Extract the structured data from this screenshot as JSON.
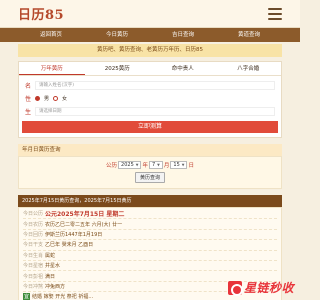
{
  "header": {
    "logo": "日历85"
  },
  "nav": [
    "返回首页",
    "今日黄历",
    "吉日查询",
    "黄道查询"
  ],
  "notice": "黄历吧、黄历查询、老黄历万年历、日历85",
  "form": {
    "tabs": [
      "万年黄历",
      "2025黄历",
      "命中贵人",
      "八字合婚"
    ],
    "name_label": "名",
    "name_placeholder": "请输入姓名(汉字)",
    "gender_label": "性",
    "gender_male": "男",
    "gender_female": "女",
    "date_label": "生",
    "date_placeholder": "请选择日期",
    "submit": "立即测算"
  },
  "query": {
    "title": "年月日黄历查询",
    "prefix": "公历",
    "year": "2025",
    "year_unit": "年",
    "month": "7",
    "month_unit": "月",
    "day": "15",
    "day_unit": "日",
    "button": "黄历查询"
  },
  "result": {
    "head": "2025年7月15日黄历查询，2025年7月15日黄历",
    "lines": [
      {
        "k": "今日公历",
        "v": "公元2025年7月15日 星期二",
        "strong": true
      },
      {
        "k": "今日农历",
        "v": "农历乙巳二零二五年 六月(大) 廿一"
      },
      {
        "k": "今日回历",
        "v": "伊斯兰历1447年1月19日"
      },
      {
        "k": "今日干支",
        "v": "乙巳年 癸未月 乙酉日"
      },
      {
        "k": "今日生肖",
        "v": "属蛇"
      },
      {
        "k": "今日星宿",
        "v": "井星水"
      },
      {
        "k": "今日彭祖",
        "v": "满日"
      },
      {
        "k": "今日冲煞",
        "v": "冲兔西方"
      }
    ],
    "yi_label": "宜",
    "yi_text": "结婚 嫁娶 开光 祭祀 祈福..."
  },
  "watermark": "星链秒收"
}
